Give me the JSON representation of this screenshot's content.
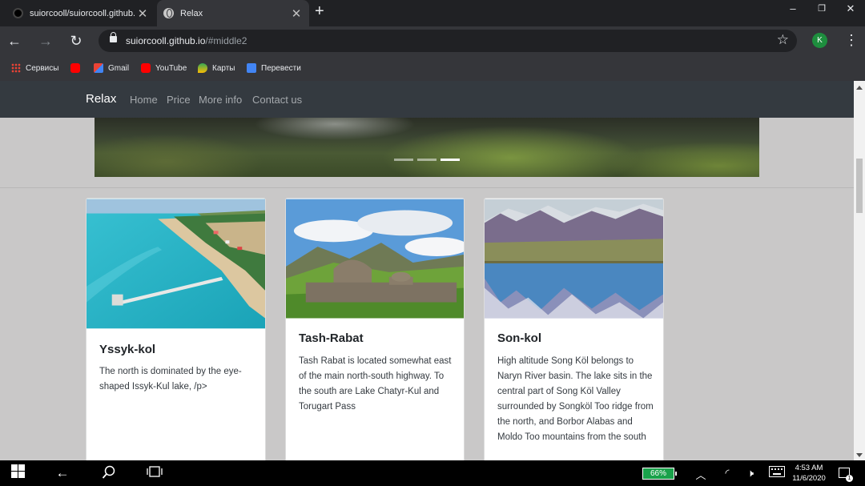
{
  "browser": {
    "tabs": [
      {
        "title": "suiorcooll/suiorcooll.github.io",
        "active": false
      },
      {
        "title": "Relax",
        "active": true
      }
    ],
    "new_tab_icon": "plus-icon",
    "window_controls": [
      "minimize-icon",
      "restore-icon",
      "close-icon"
    ],
    "url": {
      "host": "suiorcooll.github.io",
      "path": "/#middle2"
    },
    "profile_initial": "K",
    "bookmarks": [
      {
        "label": "Сервисы",
        "icon": "apps-grid-icon"
      },
      {
        "label": "",
        "icon": "youtube-icon"
      },
      {
        "label": "Gmail",
        "icon": "gmail-icon"
      },
      {
        "label": "YouTube",
        "icon": "youtube-icon"
      },
      {
        "label": "Карты",
        "icon": "maps-icon"
      },
      {
        "label": "Перевести",
        "icon": "translate-icon"
      }
    ]
  },
  "site": {
    "brand": "Relax",
    "nav": [
      "Home",
      "Price",
      "More info",
      "Contact us"
    ],
    "carousel": {
      "slides": 3,
      "active_index": 2
    },
    "cards": [
      {
        "title": "Yssyk-kol",
        "text": "The north is dominated by the eye-shaped Issyk-Kul lake, /p>",
        "image": "lake-beach-pier"
      },
      {
        "title": "Tash-Rabat",
        "text": "Tash Rabat is located somewhat east of the main north-south highway. To the south are Lake Chatyr-Kul and Torugart Pass",
        "image": "stone-caravanserai"
      },
      {
        "title": "Son-kol",
        "text": "High altitude Song Köl belongs to Naryn River basin. The lake sits in the central part of Song Köl Valley surrounded by Songköl Too ridge from the north, and Borbor Alabas and Moldo Too mountains from the south",
        "image": "mountain-lake-reflection"
      }
    ]
  },
  "taskbar": {
    "battery": "66%",
    "time": "4:53 AM",
    "date": "11/6/2020",
    "notification_count": "1"
  }
}
